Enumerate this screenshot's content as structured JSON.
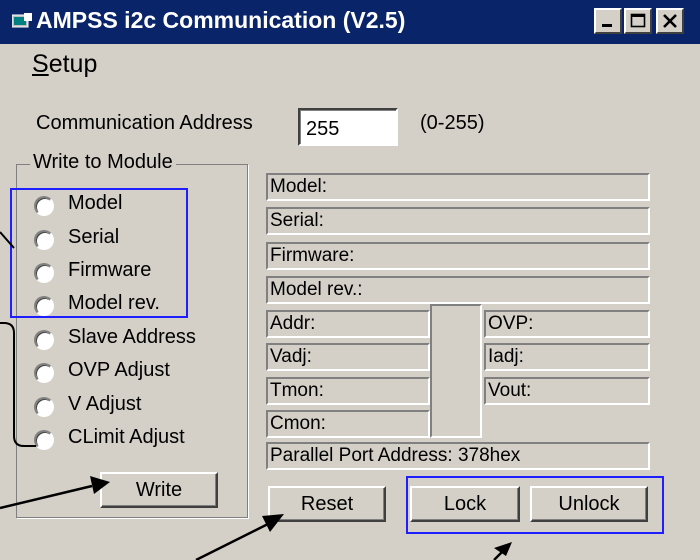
{
  "window": {
    "title": "AMPSS i2c Communication (V2.5)",
    "buttons": [
      "minimize-icon",
      "maximize-icon",
      "close-icon"
    ]
  },
  "menu": {
    "setup_prefix": "S",
    "setup_rest": "etup"
  },
  "address": {
    "label": "Communication Address",
    "value": "255",
    "range": "(0-255)"
  },
  "write_group": {
    "title": "Write to Module",
    "options": [
      "Model",
      "Serial",
      "Firmware",
      "Model rev.",
      "Slave Address",
      "OVP Adjust",
      "V Adjust",
      "CLimit Adjust"
    ],
    "write_label": "Write"
  },
  "info": {
    "model": "Model:",
    "serial": "Serial:",
    "firmware": "Firmware:",
    "model_rev": "Model rev.:",
    "addr": "Addr:",
    "vadj": "Vadj:",
    "tmon": "Tmon:",
    "cmon": "Cmon:",
    "ovp": "OVP:",
    "iadj": "Iadj:",
    "vout": "Vout:",
    "parallel_port": "Parallel Port Address: 378hex"
  },
  "actions": {
    "reset_label": "Reset",
    "lock_label": "Lock",
    "unlock_label": "Unlock"
  },
  "colors": {
    "titlebar": "#0a246a",
    "face": "#d4d0c8",
    "highlight_box": "#1e1eff"
  }
}
